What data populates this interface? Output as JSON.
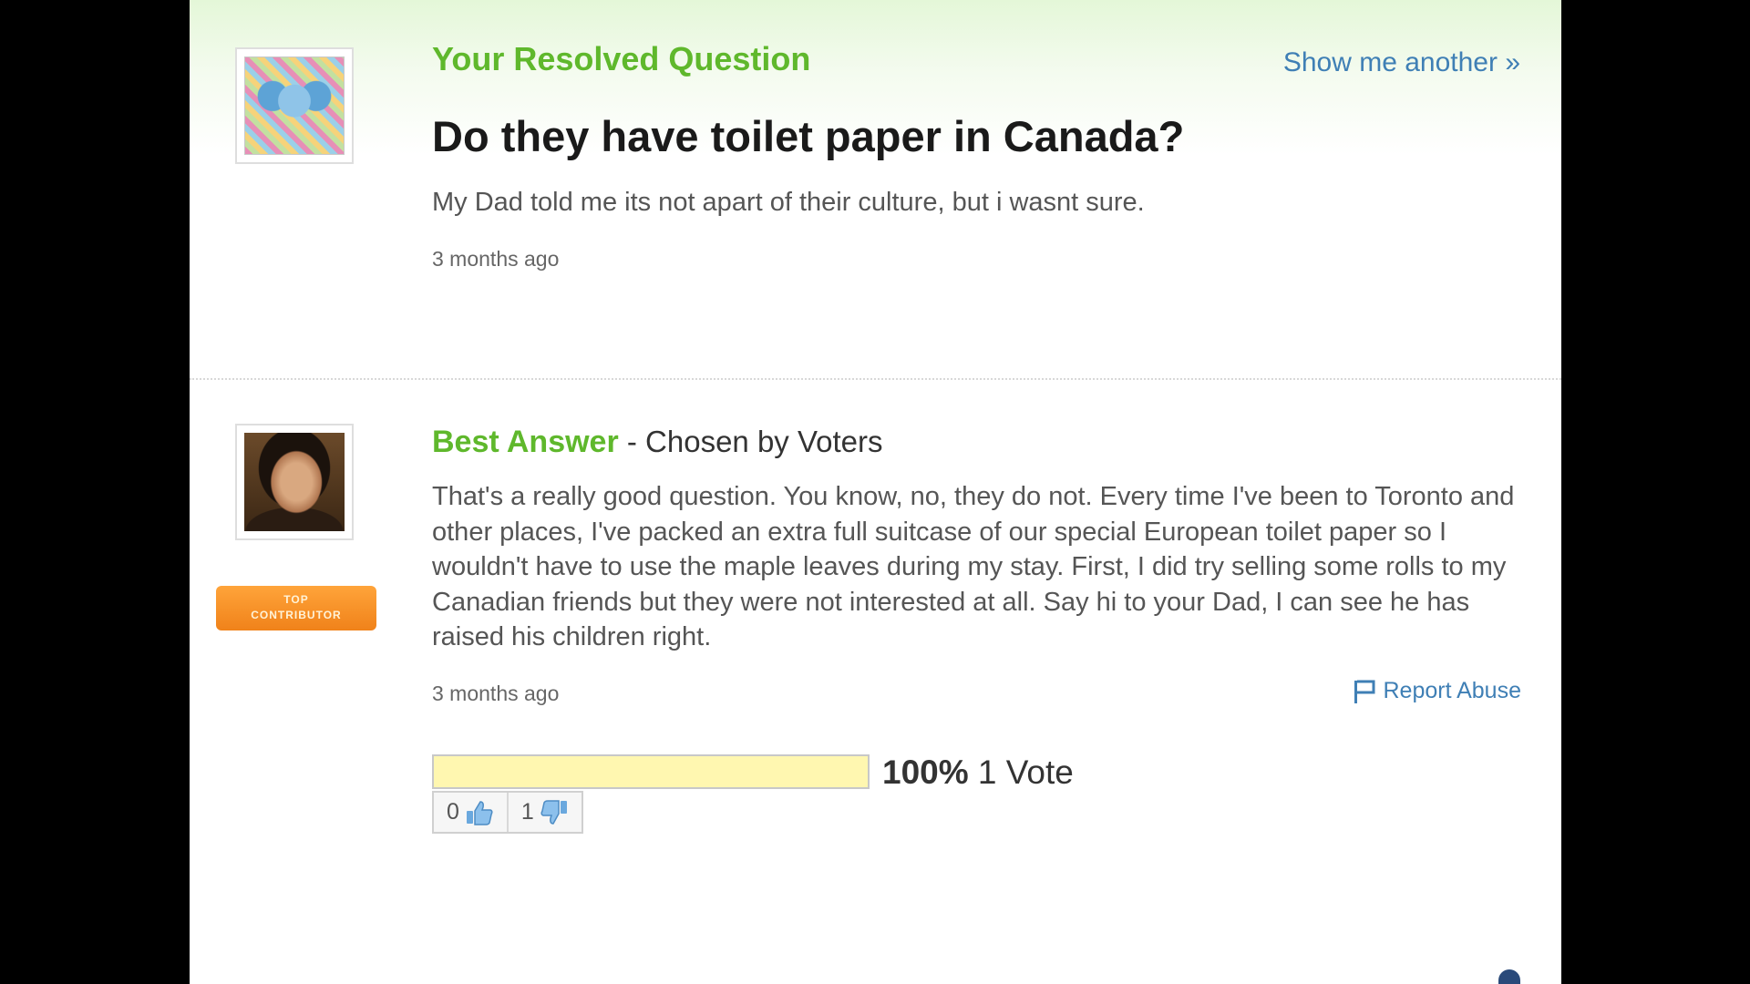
{
  "question": {
    "kicker": "Your Resolved Question",
    "show_another": "Show me another »",
    "title": "Do they have toilet paper in Canada?",
    "details": "My Dad told me its not apart of their culture, but i wasnt sure.",
    "time": "3 months ago"
  },
  "answer": {
    "label": "Best Answer",
    "chosen_by": " - Chosen by Voters",
    "badge_line1": "TOP",
    "badge_line2": "CONTRIBUTOR",
    "text": "That's a really good question. You know, no, they do not. Every time I've been to Toronto and other places, I've packed an extra full suitcase of our special European toilet paper so I wouldn't have to use the maple leaves during my stay. First, I did try selling some rolls to my Canadian friends but they were not interested at all. Say hi to your Dad, I can see he has raised his children right.",
    "time": "3 months ago",
    "report_abuse": "Report Abuse"
  },
  "votes": {
    "percent_label": "100%",
    "percent_value": 100,
    "count_label": "1 Vote",
    "thumbs_up": "0",
    "thumbs_down": "1"
  },
  "colors": {
    "accent_green": "#5fb82c",
    "link_blue": "#3f7fb5",
    "badge_orange": "#f0821a"
  },
  "icons": [
    "angel-avatar",
    "portrait-avatar",
    "flag-icon",
    "thumbs-up-icon",
    "thumbs-down-icon"
  ]
}
